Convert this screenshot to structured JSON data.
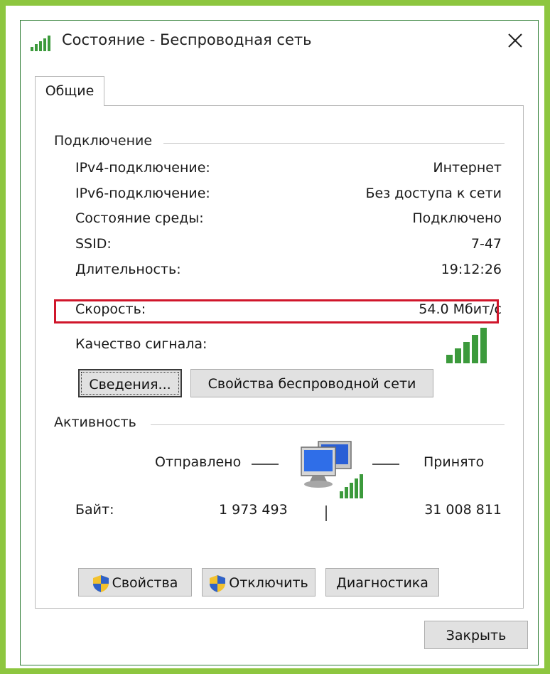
{
  "window": {
    "title": "Состояние - Беспроводная сеть",
    "close_label": "✕"
  },
  "tabs": [
    {
      "label": "Общие",
      "selected": true
    }
  ],
  "connection": {
    "heading": "Подключение",
    "rows": [
      {
        "label": "IPv4-подключение:",
        "value": "Интернет"
      },
      {
        "label": "IPv6-подключение:",
        "value": "Без доступа к сети"
      },
      {
        "label": "Состояние среды:",
        "value": "Подключено"
      },
      {
        "label": "SSID:",
        "value": "7-47"
      },
      {
        "label": "Длительность:",
        "value": "19:12:26"
      },
      {
        "label": "Скорость:",
        "value": "54.0 Мбит/с"
      }
    ],
    "signal_label": "Качество сигнала:",
    "signal_bars_active": 5,
    "details_button": "Сведения...",
    "wireless_props_button": "Свойства беспроводной сети"
  },
  "activity": {
    "heading": "Активность",
    "sent_label": "Отправлено",
    "received_label": "Принято",
    "bytes_label": "Байт:",
    "bytes_sent": "1 973 493",
    "bytes_received": "31 008 811"
  },
  "buttons": {
    "properties": "Свойства",
    "disconnect": "Отключить",
    "diagnostics": "Диагностика",
    "close": "Закрыть"
  },
  "colors": {
    "frame_green": "#8dc63f",
    "signal_green": "#3c9a3c",
    "highlight_red": "#d0162b"
  }
}
